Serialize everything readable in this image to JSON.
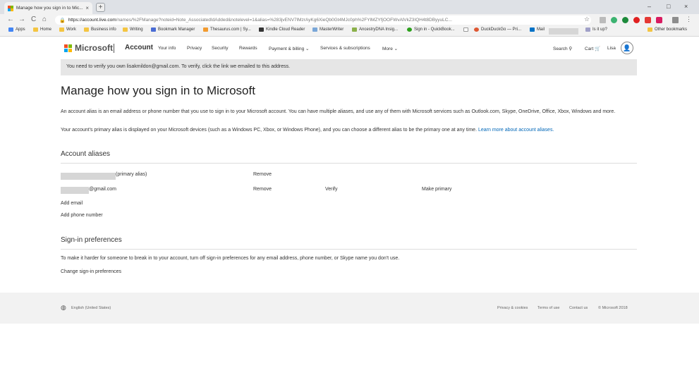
{
  "browser": {
    "tab_title": "Manage how you sign in to Mic...",
    "tab_close": "×",
    "new_tab": "+",
    "window_controls": {
      "minimize": "–",
      "maximize": "□",
      "close": "×"
    },
    "nav": {
      "back": "←",
      "forward": "→",
      "reload": "C",
      "home": "⌂"
    },
    "url_host": "https://account.live.com",
    "url_path": "/names/%2FManage?noteid=Note_AssociatedIdAdded&notelevel=1&alias=%283jvENV7lMzrAyKg6XieQb0Gt4MJc0ph%2FYlMZYfjOOFWvAlVkZ3IQH4t8DByyuLC...",
    "bookmarks": [
      {
        "label": "Apps",
        "icon": "apps-grid-icon"
      },
      {
        "label": "Home",
        "icon": "folder-icon"
      },
      {
        "label": "Work",
        "icon": "folder-icon"
      },
      {
        "label": "Business info",
        "icon": "folder-icon"
      },
      {
        "label": "Writing",
        "icon": "folder-icon"
      },
      {
        "label": "Bookmark Manager",
        "icon": "star-icon"
      },
      {
        "label": "Thesaurus.com | Sy...",
        "icon": "thesaurus-icon"
      },
      {
        "label": "Kindle Cloud Reader",
        "icon": "kindle-icon"
      },
      {
        "label": "MasterWriter",
        "icon": "masterwriter-icon"
      },
      {
        "label": "AncestryDNA Insig...",
        "icon": "ancestry-icon"
      },
      {
        "label": "Sign in - QuickBook...",
        "icon": "quickbooks-icon"
      },
      {
        "label": "DuckDuckGo — Pri...",
        "icon": "duckduckgo-icon"
      },
      {
        "label": "Mail",
        "icon": "outlook-icon"
      },
      {
        "label": "Is it up?",
        "icon": "link-icon"
      },
      {
        "label": "Other bookmarks",
        "icon": "folder-icon"
      }
    ]
  },
  "header": {
    "brand": "Microsoft",
    "account": "Account",
    "nav": [
      "Your info",
      "Privacy",
      "Security",
      "Rewards",
      "Payment & billing ⌄",
      "Services & subscriptions",
      "More ⌄"
    ],
    "search": "Search",
    "cart": "Cart",
    "user": "Lisa"
  },
  "notice": "You need to verify you own lisakmildon@gmail.com. To verify, click the link we emailed to this address.",
  "main": {
    "title": "Manage how you sign in to Microsoft",
    "intro1": "An account alias is an email address or phone number that you use to sign in to your Microsoft account. You can have multiple aliases, and use any of them with Microsoft services such as Outlook.com, Skype, OneDrive, Office, Xbox, Windows and more.",
    "intro2": "Your account's primary alias is displayed on your Microsoft devices (such as a Windows PC, Xbox, or Windows Phone), and you can choose a different alias to be the primary one at any time.",
    "learn_more": "Learn more about account aliases.",
    "aliases_heading": "Account aliases",
    "aliases": [
      {
        "suffix": "(primary alias)",
        "remove": "Remove"
      },
      {
        "suffix": "@gmail.com",
        "remove": "Remove",
        "verify": "Verify",
        "make_primary": "Make primary"
      }
    ],
    "add_email": "Add email",
    "add_phone": "Add phone number",
    "signin_heading": "Sign-in preferences",
    "signin_text": "To make it harder for someone to break in to your account, turn off sign-in preferences for any email address, phone number, or Skype name you don't use.",
    "change_prefs": "Change sign-in preferences"
  },
  "footer": {
    "language": "English (United States)",
    "privacy": "Privacy & cookies",
    "terms": "Terms of use",
    "contact": "Contact us",
    "copyright": "© Microsoft 2018"
  },
  "colors": {
    "link": "#0067b8",
    "ms_red": "#f25022",
    "ms_green": "#7fba00",
    "ms_blue": "#00a4ef",
    "ms_yellow": "#ffb900"
  }
}
